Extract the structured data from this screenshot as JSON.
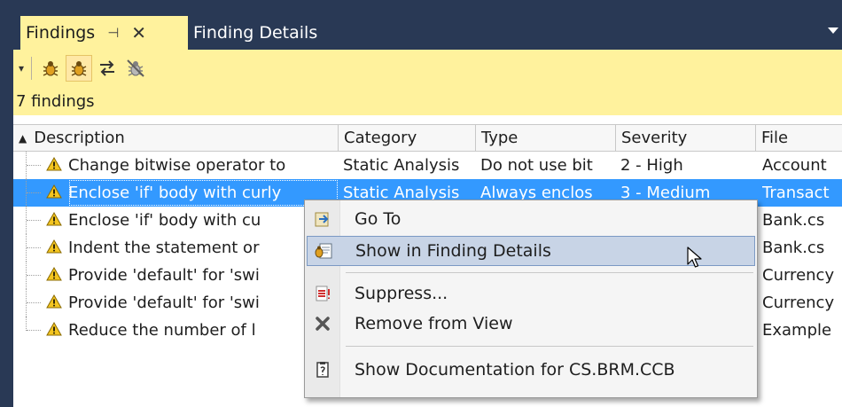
{
  "tabs": {
    "active_label": "Findings",
    "pin_glyph": "⊣",
    "close_glyph": "✕",
    "inactive_label": "Finding Details"
  },
  "toolbar": {
    "icons": [
      "dropdown-icon",
      "bug-icon",
      "bug-highlighted-icon",
      "sync-icon",
      "bug-disabled-icon"
    ]
  },
  "count_text": "7 findings",
  "grid": {
    "columns": [
      "Description",
      "Category",
      "Type",
      "Severity",
      "File"
    ],
    "rows": [
      {
        "description": "Change bitwise operator to",
        "category": "Static Analysis",
        "type": "Do not use bit",
        "severity": "2 - High",
        "file": "Account"
      },
      {
        "description": "Enclose 'if' body with curly",
        "category": "Static Analysis",
        "type": "Always enclos",
        "severity": "3 - Medium",
        "file": "Transact"
      },
      {
        "description": "Enclose 'if' body with cu",
        "category": "",
        "type": "",
        "severity": "",
        "file": "Bank.cs"
      },
      {
        "description": "Indent the statement or",
        "category": "",
        "type": "",
        "severity": "",
        "file": "Bank.cs"
      },
      {
        "description": "Provide 'default' for 'swi",
        "category": "",
        "type": "",
        "severity": "",
        "file": "Currency"
      },
      {
        "description": "Provide 'default' for 'swi",
        "category": "",
        "type": "",
        "severity": "",
        "file": "Currency"
      },
      {
        "description": "Reduce the number of l",
        "category": "",
        "type": "",
        "severity": "",
        "file": "Example"
      }
    ]
  },
  "context_menu": {
    "items": [
      {
        "label": "Go To",
        "icon": "goto-icon"
      },
      {
        "label": "Show in Finding Details",
        "icon": "finding-details-icon"
      },
      {
        "label": "Suppress...",
        "icon": "suppress-icon"
      },
      {
        "label": "Remove from View",
        "icon": "remove-icon"
      },
      {
        "label": "Show Documentation for CS.BRM.CCB",
        "icon": "documentation-icon"
      }
    ]
  },
  "colors": {
    "frame": "#293955",
    "tab_active": "#fff29d",
    "selection": "#3399ff",
    "menu_hover": "#c8d4e6",
    "warning": "#f4c520"
  }
}
